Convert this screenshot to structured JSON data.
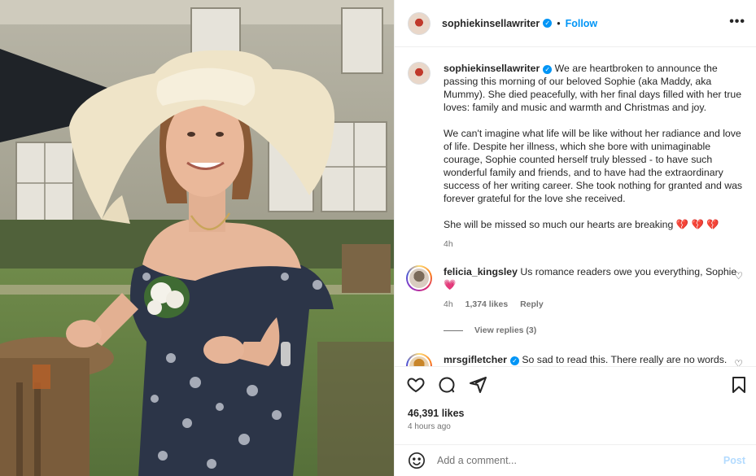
{
  "post": {
    "author": "sophiekinsellawriter",
    "separator": "•",
    "follow_label": "Follow",
    "more_icon": "more-horizontal-icon",
    "photo_alt": "Photo of a woman in a wide-brimmed hat at a garden party"
  },
  "caption": {
    "author": "sophiekinsellawriter",
    "p1": "We are heartbroken to announce the passing this morning of our beloved Sophie (aka Maddy, aka Mummy). She died peacefully, with her final days filled with her true loves: family and music and warmth and Christmas and joy.",
    "p2": "We can't imagine what life will be like without her radiance and love of life. Despite her illness, which she bore with unimaginable courage, Sophie counted herself truly blessed - to have such wonderful family and friends, and to have had the extraordinary success of her writing career. She took nothing for granted and was forever grateful for the love she received.",
    "p3": "She will be missed so much our hearts are breaking",
    "p3_emoji": "💔 💔 💔",
    "time": "4h"
  },
  "comments": [
    {
      "author": "felicia_kingsley",
      "text": "Us romance readers owe you everything, Sophie",
      "emoji": "💗",
      "time": "4h",
      "likes": "1,374 likes",
      "reply_label": "Reply",
      "view_replies": "View replies (3)"
    },
    {
      "author": "mrsgifletcher",
      "text": "So sad to read this. There really are no words."
    }
  ],
  "actions": {
    "likes": "46,391 likes",
    "time": "4 hours ago"
  },
  "composer": {
    "placeholder": "Add a comment...",
    "post_label": "Post"
  },
  "colors": {
    "accent": "#0095f6",
    "verified": "#0095f6",
    "heart": "#e0245e",
    "post_disabled": "#b3dbff"
  }
}
